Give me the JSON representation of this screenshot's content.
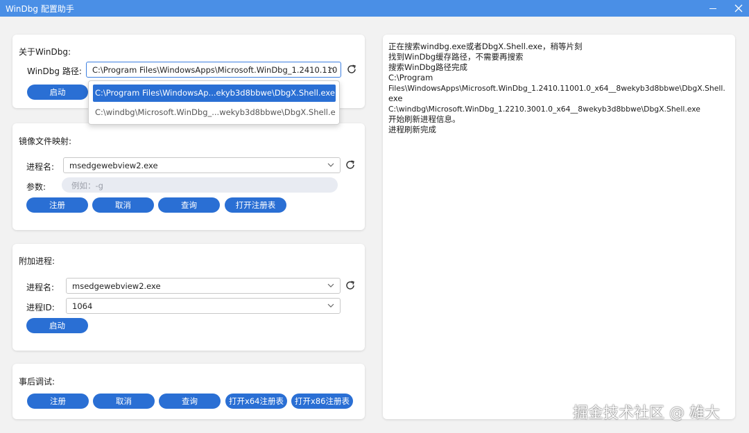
{
  "window": {
    "title": "WinDbg 配置助手"
  },
  "about": {
    "label": "关于WinDbg:",
    "path_label": "WinDbg 路径:",
    "path_value": "C:\\Program Files\\WindowsApps\\Microsoft.WinDbg_1.2410.110",
    "start_button": "启动",
    "dropdown_options": [
      "C:\\Program Files\\WindowsAp...ekyb3d8bbwe\\DbgX.Shell.exe",
      "C:\\windbg\\Microsoft.WinDbg_...wekyb3d8bbwe\\DbgX.Shell.exe"
    ]
  },
  "ifeo": {
    "label": "镜像文件映射:",
    "process_label": "进程名:",
    "process_value": "msedgewebview2.exe",
    "args_label": "参数:",
    "args_placeholder": "例如：-g",
    "buttons": [
      "注册",
      "取消",
      "查询",
      "打开注册表"
    ]
  },
  "attach": {
    "label": "附加进程:",
    "process_label": "进程名:",
    "process_value": "msedgewebview2.exe",
    "pid_label": "进程ID:",
    "pid_value": "1064",
    "start_button": "启动"
  },
  "postmortem": {
    "label": "事后调试:",
    "buttons": [
      "注册",
      "取消",
      "查询",
      "打开x64注册表",
      "打开x86注册表"
    ]
  },
  "log": {
    "lines": [
      "正在搜索windbg.exe或者DbgX.Shell.exe，稍等片刻",
      "找到WinDbg缓存路径，不需要再搜索",
      "搜索WinDbg路径完成",
      "C:\\Program",
      "Files\\WindowsApps\\Microsoft.WinDbg_1.2410.11001.0_x64__8wekyb3d8bbwe\\DbgX.Shell.",
      "exe",
      "C:\\windbg\\Microsoft.WinDbg_1.2210.3001.0_x64__8wekyb3d8bbwe\\DbgX.Shell.exe",
      "开始刷新进程信息。",
      "进程刷新完成"
    ]
  },
  "watermark": "掘金技术社区 @ 雄大",
  "colors": {
    "titlebar": "#4a8fe6",
    "button": "#2a6fd4",
    "background": "#f2f2f2"
  },
  "icons": [
    "refresh-icon",
    "chevron-down-icon",
    "chevron-up-icon",
    "close-icon",
    "minimize-icon"
  ]
}
